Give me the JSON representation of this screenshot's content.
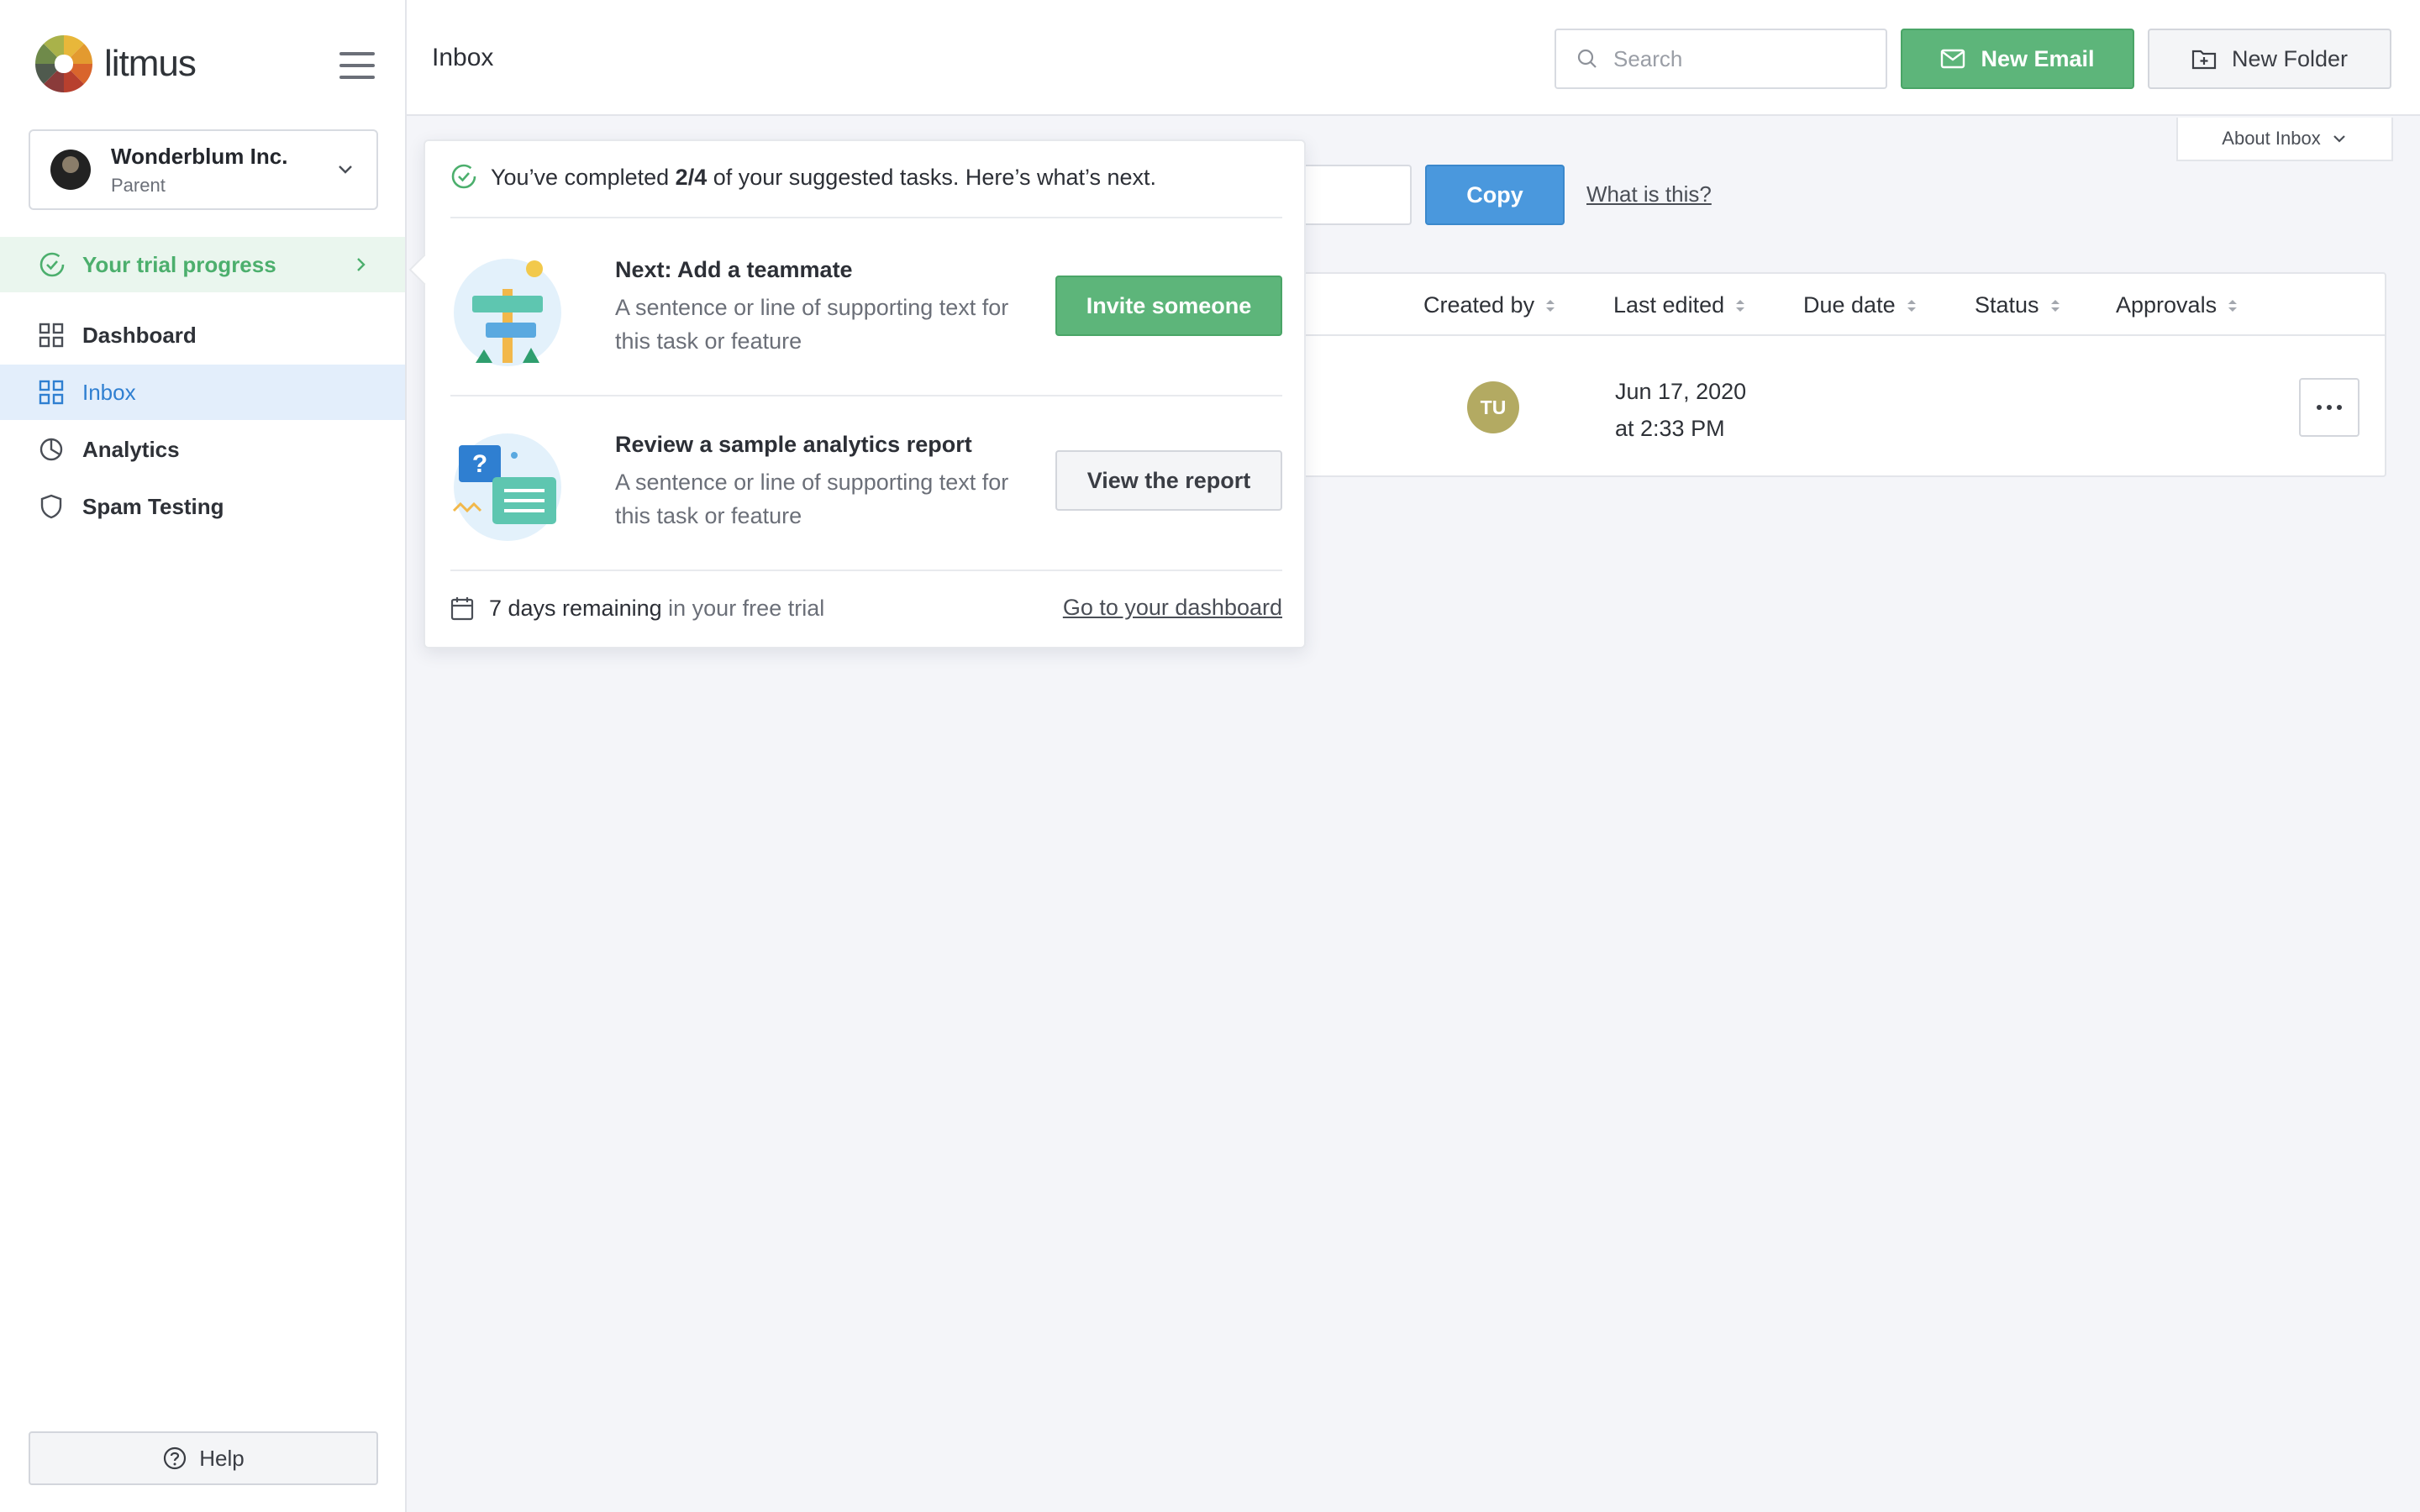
{
  "brand": {
    "name": "litmus"
  },
  "org": {
    "name": "Wonderblum Inc.",
    "role": "Parent"
  },
  "sidebar": {
    "trial_progress": "Your trial progress",
    "items": [
      {
        "label": "Dashboard",
        "icon": "grid-icon"
      },
      {
        "label": "Inbox",
        "icon": "grid-icon",
        "active": true
      },
      {
        "label": "Analytics",
        "icon": "pie-chart-icon"
      },
      {
        "label": "Spam Testing",
        "icon": "shield-icon"
      }
    ],
    "help_label": "Help"
  },
  "header": {
    "title": "Inbox",
    "search_placeholder": "Search",
    "new_email_label": "New Email",
    "new_folder_label": "New Folder",
    "about_label": "About Inbox"
  },
  "toolbar": {
    "copy_label": "Copy",
    "what_link": "What is this?"
  },
  "table": {
    "columns": [
      "Created by",
      "Last edited",
      "Due date",
      "Status",
      "Approvals"
    ],
    "rows": [
      {
        "created_by_initials": "TU",
        "last_edited_date": "Jun 17, 2020",
        "last_edited_time": "at 2:33 PM"
      }
    ]
  },
  "popover": {
    "header_prefix": "You’ve completed",
    "header_count": "2/4",
    "header_suffix": "of your suggested tasks.",
    "header_next": "Here’s what’s next.",
    "tasks": [
      {
        "title": "Next: Add a teammate",
        "desc": "A sentence or line of supporting text for this task or feature",
        "button": "Invite someone"
      },
      {
        "title": "Review a sample analytics report",
        "desc": "A sentence or line of supporting text for this task or feature",
        "button": "View the report"
      }
    ],
    "footer_days": "7 days remaining",
    "footer_suffix": "in your free trial",
    "dashboard_link": "Go to your dashboard"
  },
  "colors": {
    "accent_green": "#5db57a",
    "accent_blue": "#4a98dd",
    "active_nav_bg": "#e3eefb",
    "trial_bg": "#eaf6ee",
    "avatar_tu": "#b3aa62"
  }
}
